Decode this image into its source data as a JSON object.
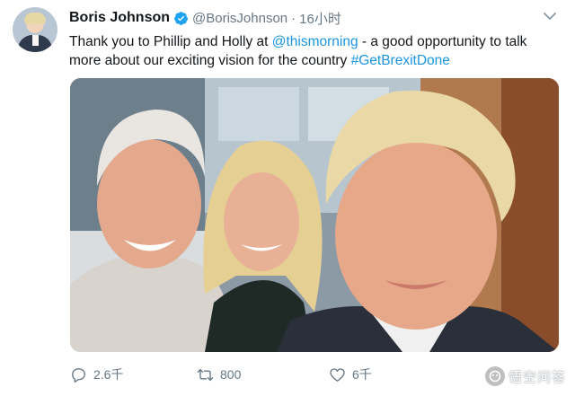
{
  "tweet": {
    "author_name": "Boris Johnson",
    "handle": "@BorisJohnson",
    "separator": "·",
    "time": "16小时",
    "text_intro": "Thank you to Phillip and Holly at ",
    "mention": "@thismorning",
    "text_middle": " - a good opportunity to talk more about our exciting vision for the country ",
    "hashtag": "#GetBrexitDone"
  },
  "actions": {
    "reply_count": "2.6千",
    "retweet_count": "800",
    "like_count": "6千"
  },
  "watermark": {
    "text": "悟空问答"
  },
  "colors": {
    "link": "#1b95e0",
    "muted": "#657786",
    "verified": "#1da1f2"
  },
  "icons": [
    "verified-badge-icon",
    "chevron-down-icon",
    "reply-icon",
    "retweet-icon",
    "like-icon",
    "wukong-logo-icon"
  ]
}
